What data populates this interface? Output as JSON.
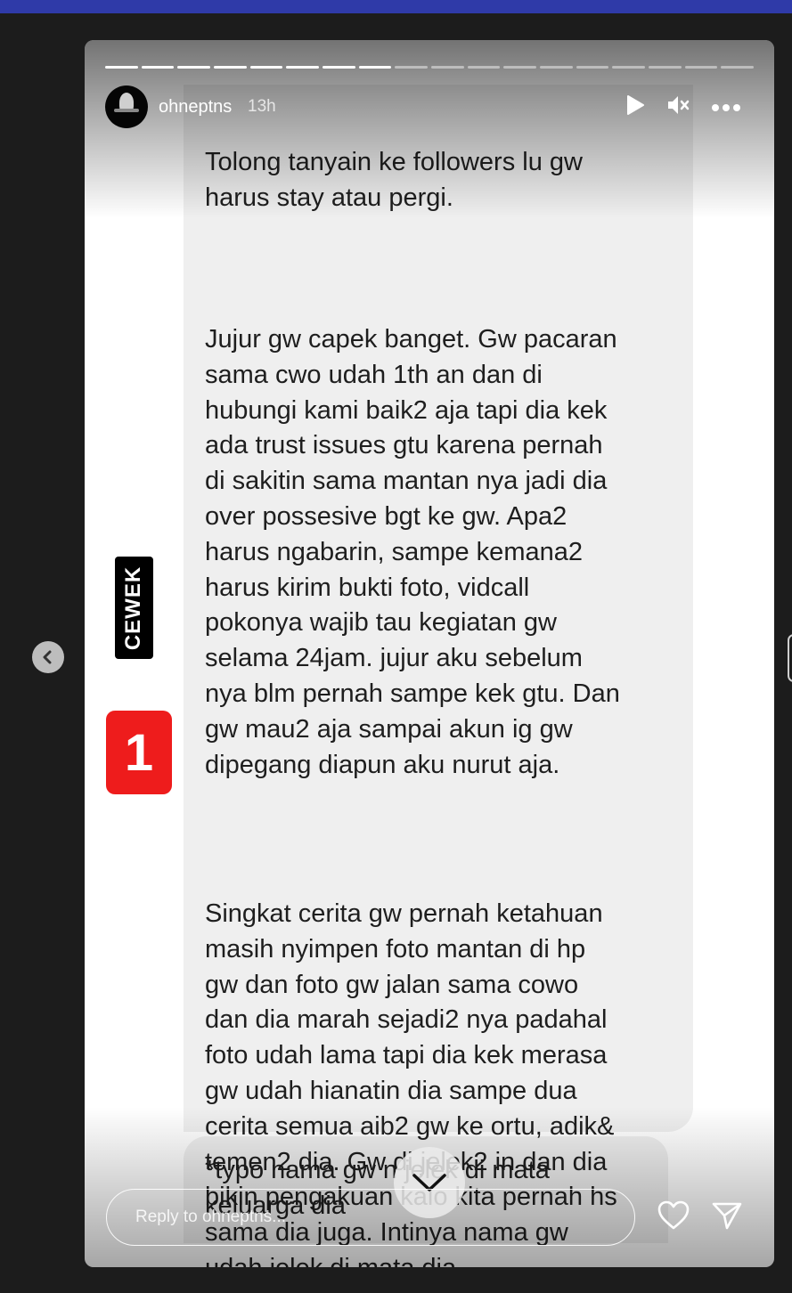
{
  "story": {
    "username": "ohneptns",
    "time_ago": "13h",
    "progress": {
      "segments_total": 18,
      "segments_viewed": 8
    },
    "message_paragraphs": [
      "Tolong tanyain ke followers lu gw\nharus stay atau pergi.",
      "Jujur gw capek banget. Gw pacaran\nsama cwo udah 1th an dan di\nhubungi kami baik2 aja tapi dia kek\nada trust issues gtu karena pernah\ndi sakitin sama mantan nya jadi dia\nover possesive bgt ke gw. Apa2\nharus ngabarin, sampe kemana2\nharus kirim bukti foto, vidcall\npokonya wajib tau kegiatan gw\nselama 24jam. jujur aku sebelum\nnya blm pernah sampe kek gtu. Dan\ngw mau2 aja sampai akun ig gw\ndipegang diapun aku nurut aja.",
      "Singkat cerita gw pernah ketahuan\nmasih nyimpen foto mantan di hp\ngw dan foto gw jalan sama cowo\ndan dia marah sejadi2 nya padahal\nfoto udah lama tapi dia kek merasa\ngw udah hianatin dia sampe dua\ncerita semua aib2 gw ke ortu, adik&\ntemen2 dia. Gw di jelek2 in dan dia\nbikin pengakuan kalo kita pernah hs\nsama dia juga. Intinya nama gw\nudah jelek di mata dia"
    ],
    "message_followup": "*typo nama gw      n jelek di mata\nkeluarga dia",
    "side_label": "CEWEK",
    "number_badge": "1",
    "reply_placeholder": "Reply to ohneptns..."
  },
  "icons": {
    "play": "play-icon",
    "mute": "mute-icon",
    "more": "more-icon",
    "chevron": "chevron-down-icon",
    "heart": "heart-icon",
    "send": "send-icon",
    "prev": "chevron-left-icon"
  },
  "colors": {
    "page_bg": "#1c1c1c",
    "top_bar": "#2f3aa8",
    "bubble": "#efefef",
    "badge_red": "#ee1c1c",
    "label_black": "#000000"
  }
}
